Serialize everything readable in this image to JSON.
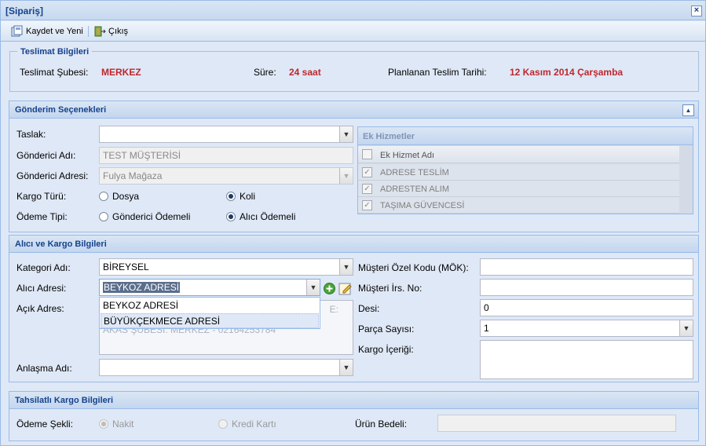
{
  "window": {
    "title": "[Sipariş]"
  },
  "toolbar": {
    "save_new": "Kaydet ve Yeni",
    "exit": "Çıkış"
  },
  "delivery": {
    "legend": "Teslimat Bilgileri",
    "branch_label": "Teslimat Şubesi:",
    "branch_value": "MERKEZ",
    "duration_label": "Süre:",
    "duration_value": "24 saat",
    "planned_label": "Planlanan Teslim Tarihi:",
    "planned_value": "12 Kasım 2014 Çarşamba"
  },
  "shipping": {
    "title": "Gönderim Seçenekleri",
    "template_label": "Taslak:",
    "template_value": "",
    "sender_name_label": "Gönderici Adı:",
    "sender_name_value": "TEST MÜŞTERİSİ",
    "sender_address_label": "Gönderici Adresi:",
    "sender_address_value": "Fulya Mağaza",
    "cargo_type_label": "Kargo Türü:",
    "cargo_type_options": [
      "Dosya",
      "Koli"
    ],
    "cargo_type_selected": "Koli",
    "payment_type_label": "Ödeme Tipi:",
    "payment_type_options": [
      "Gönderici Ödemeli",
      "Alıcı Ödemeli"
    ],
    "payment_type_selected": "Alıcı Ödemeli",
    "extra": {
      "title": "Ek Hizmetler",
      "column": "Ek Hizmet Adı",
      "rows": [
        "ADRESE TESLİM",
        "ADRESTEN ALIM",
        "TAŞIMA GÜVENCESİ"
      ]
    }
  },
  "recipient": {
    "title": "Alıcı ve Kargo Bilgileri",
    "category_label": "Kategori Adı:",
    "category_value": "BİREYSEL",
    "address_label": "Alıcı Adresi:",
    "address_value": "BEYKOZ ADRESİ",
    "open_address_label": "Açık Adres:",
    "open_address_partial_line1": "E:",
    "open_address_partial_line2": "AKAS ŞUBESI: MERKEZ - 02164253784",
    "agreement_label": "Anlaşma Adı:",
    "agreement_value": "",
    "address_dropdown": [
      "BEYKOZ ADRESİ",
      "BÜYÜKÇEKMECE ADRESİ"
    ],
    "customer_code_label": "Müşteri Özel Kodu (MÖK):",
    "customer_code_value": "",
    "waybill_label": "Müşteri İrs. No:",
    "waybill_value": "",
    "desi_label": "Desi:",
    "desi_value": "0",
    "pieces_label": "Parça Sayısı:",
    "pieces_value": "1",
    "contents_label": "Kargo İçeriği:",
    "contents_value": ""
  },
  "cod": {
    "title": "Tahsilatlı Kargo Bilgileri",
    "payment_method_label": "Ödeme Şekli:",
    "payment_method_options": [
      "Nakit",
      "Kredi Kartı"
    ],
    "payment_method_selected": "Nakit",
    "product_price_label": "Ürün Bedeli:",
    "product_price_value": ""
  },
  "colors": {
    "accent": "#15428b",
    "value_red": "#c0272d",
    "panel_bg": "#dfe8f6",
    "border": "#99bbe8"
  }
}
